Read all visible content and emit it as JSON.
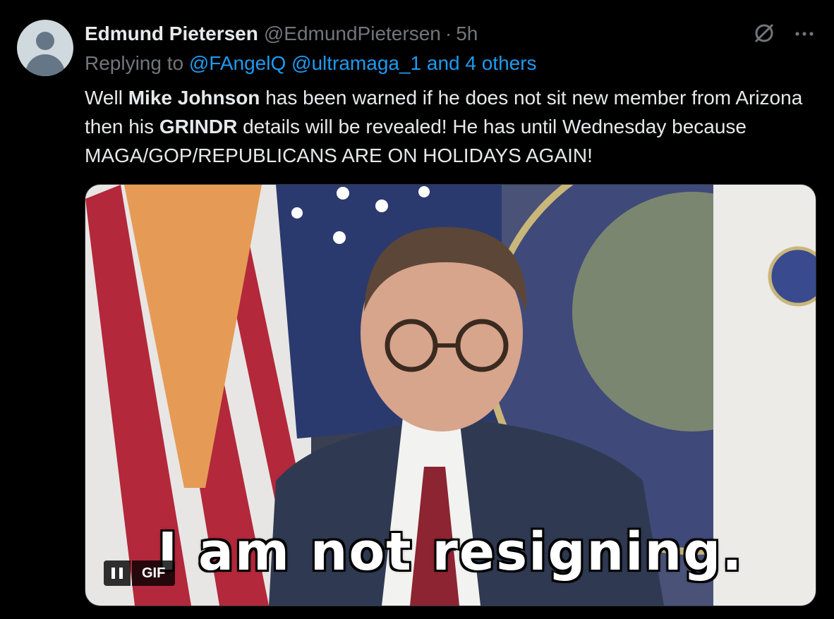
{
  "tweet": {
    "author_name": "Edmund Pietersen",
    "author_handle": "@EdmundPietersen",
    "separator": "·",
    "time": "5h",
    "replying_prefix": "Replying to",
    "reply_mention_1": "@FAngelQ",
    "reply_mention_2": "@ultramaga_1",
    "reply_others": "and 4 others",
    "text": {
      "part1": "Well ",
      "bold1": "Mike Johnson",
      "part2": " has been warned if he does not sit new member from Arizona then his ",
      "bold2": "GRINDR",
      "part3": " details will be revealed! He has until Wednesday because MAGA/GOP/REPUBLICANS ARE ON HOLIDAYS AGAIN!"
    }
  },
  "media": {
    "caption": "I am not resigning.",
    "gif_label": "GIF",
    "pause_icon": "pause-icon"
  },
  "icons": {
    "grok": "grok-icon",
    "more": "more-icon",
    "avatar": "default-avatar"
  },
  "colors": {
    "background": "#000000",
    "text": "#e7e9ea",
    "muted": "#71767b",
    "link": "#1d9bf0"
  }
}
